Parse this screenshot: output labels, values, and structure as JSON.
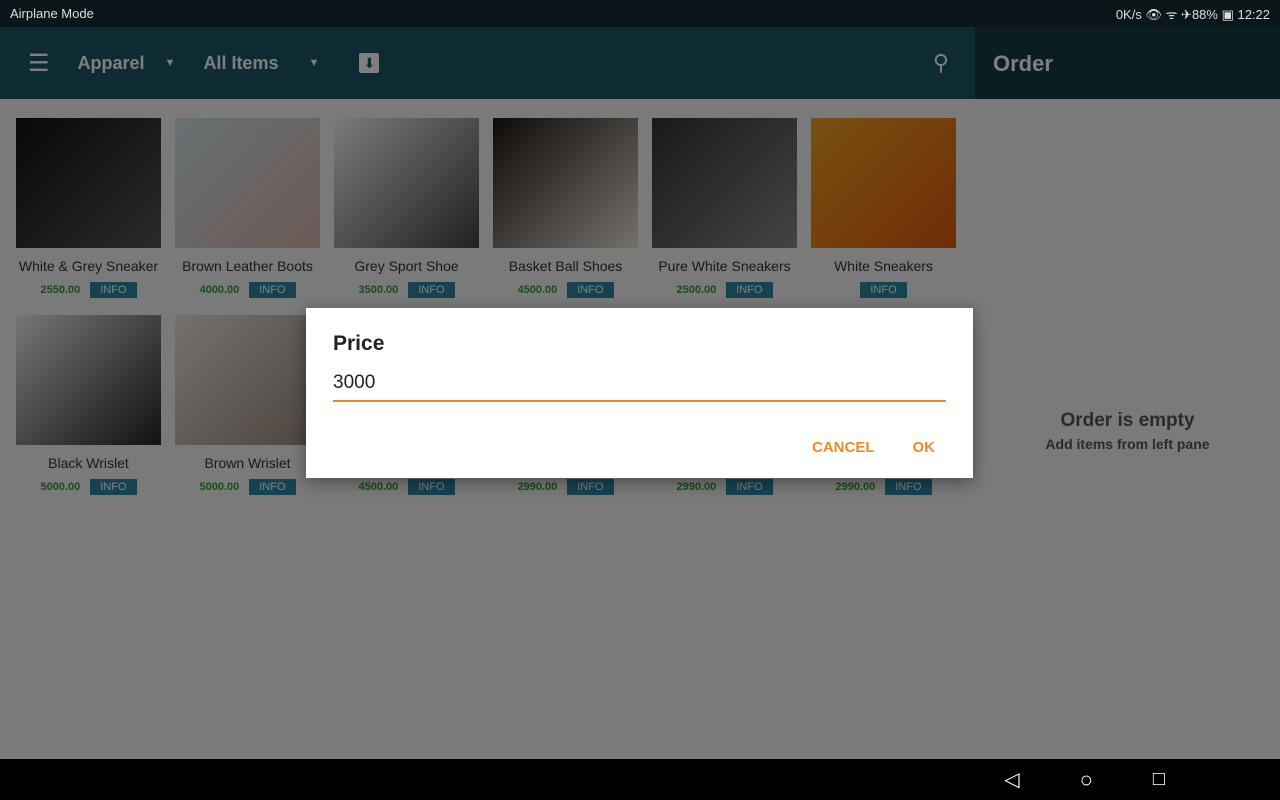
{
  "status": {
    "left": "Airplane Mode",
    "right": "0K/s 👁 ᯤ ✈88% ▣ 12:22"
  },
  "toolbar": {
    "category": "Apparel",
    "filter": "All Items",
    "order_title": "Order"
  },
  "items": [
    {
      "name": "White & Grey Sneaker",
      "price": "2550.00",
      "info": "INFO",
      "img": [
        "#111",
        "#555"
      ]
    },
    {
      "name": "Brown Leather Boots",
      "price": "4000.00",
      "info": "INFO",
      "img": [
        "#cfe3e8",
        "#d7b3a8"
      ]
    },
    {
      "name": "Grey Sport Shoe",
      "price": "3500.00",
      "info": "INFO",
      "img": [
        "#f4f4f4",
        "#444"
      ]
    },
    {
      "name": "Basket Ball Shoes",
      "price": "4500.00",
      "info": "INFO",
      "img": [
        "#1a1410",
        "#e9e2d6"
      ]
    },
    {
      "name": "Pure White Sneakers",
      "price": "2500.00",
      "info": "INFO",
      "img": [
        "#333",
        "#888"
      ]
    },
    {
      "name": "White Sneakers",
      "price": "",
      "info": "INFO",
      "img": [
        "#f0a020",
        "#e05a10"
      ]
    },
    {
      "name": "Black Wrislet",
      "price": "5000.00",
      "info": "INFO",
      "img": [
        "#ececec",
        "#222"
      ]
    },
    {
      "name": "Brown Wrislet",
      "price": "5000.00",
      "info": "INFO",
      "img": [
        "#e8e2dc",
        "#9a8a7e"
      ]
    },
    {
      "name": "",
      "price": "4500.00",
      "info": "INFO",
      "img": [
        "#ddd",
        "#bbb"
      ]
    },
    {
      "name": "",
      "price": "2990.00",
      "info": "INFO",
      "img": [
        "#ddd",
        "#bbb"
      ]
    },
    {
      "name": "",
      "price": "2990.00",
      "info": "INFO",
      "img": [
        "#ddd",
        "#bbb"
      ]
    },
    {
      "name": "",
      "price": "2990.00",
      "info": "INFO",
      "img": [
        "#ddd",
        "#bbb"
      ]
    }
  ],
  "order": {
    "empty_title": "Order is empty",
    "empty_sub": "Add items from left pane"
  },
  "dialog": {
    "title": "Price",
    "value": "3000",
    "cancel": "CANCEL",
    "ok": "OK"
  },
  "colors": {
    "toolbar": "#1d5566",
    "accent": "#f08a24",
    "price": "#2e9b2e",
    "info": "#2c87a4"
  }
}
